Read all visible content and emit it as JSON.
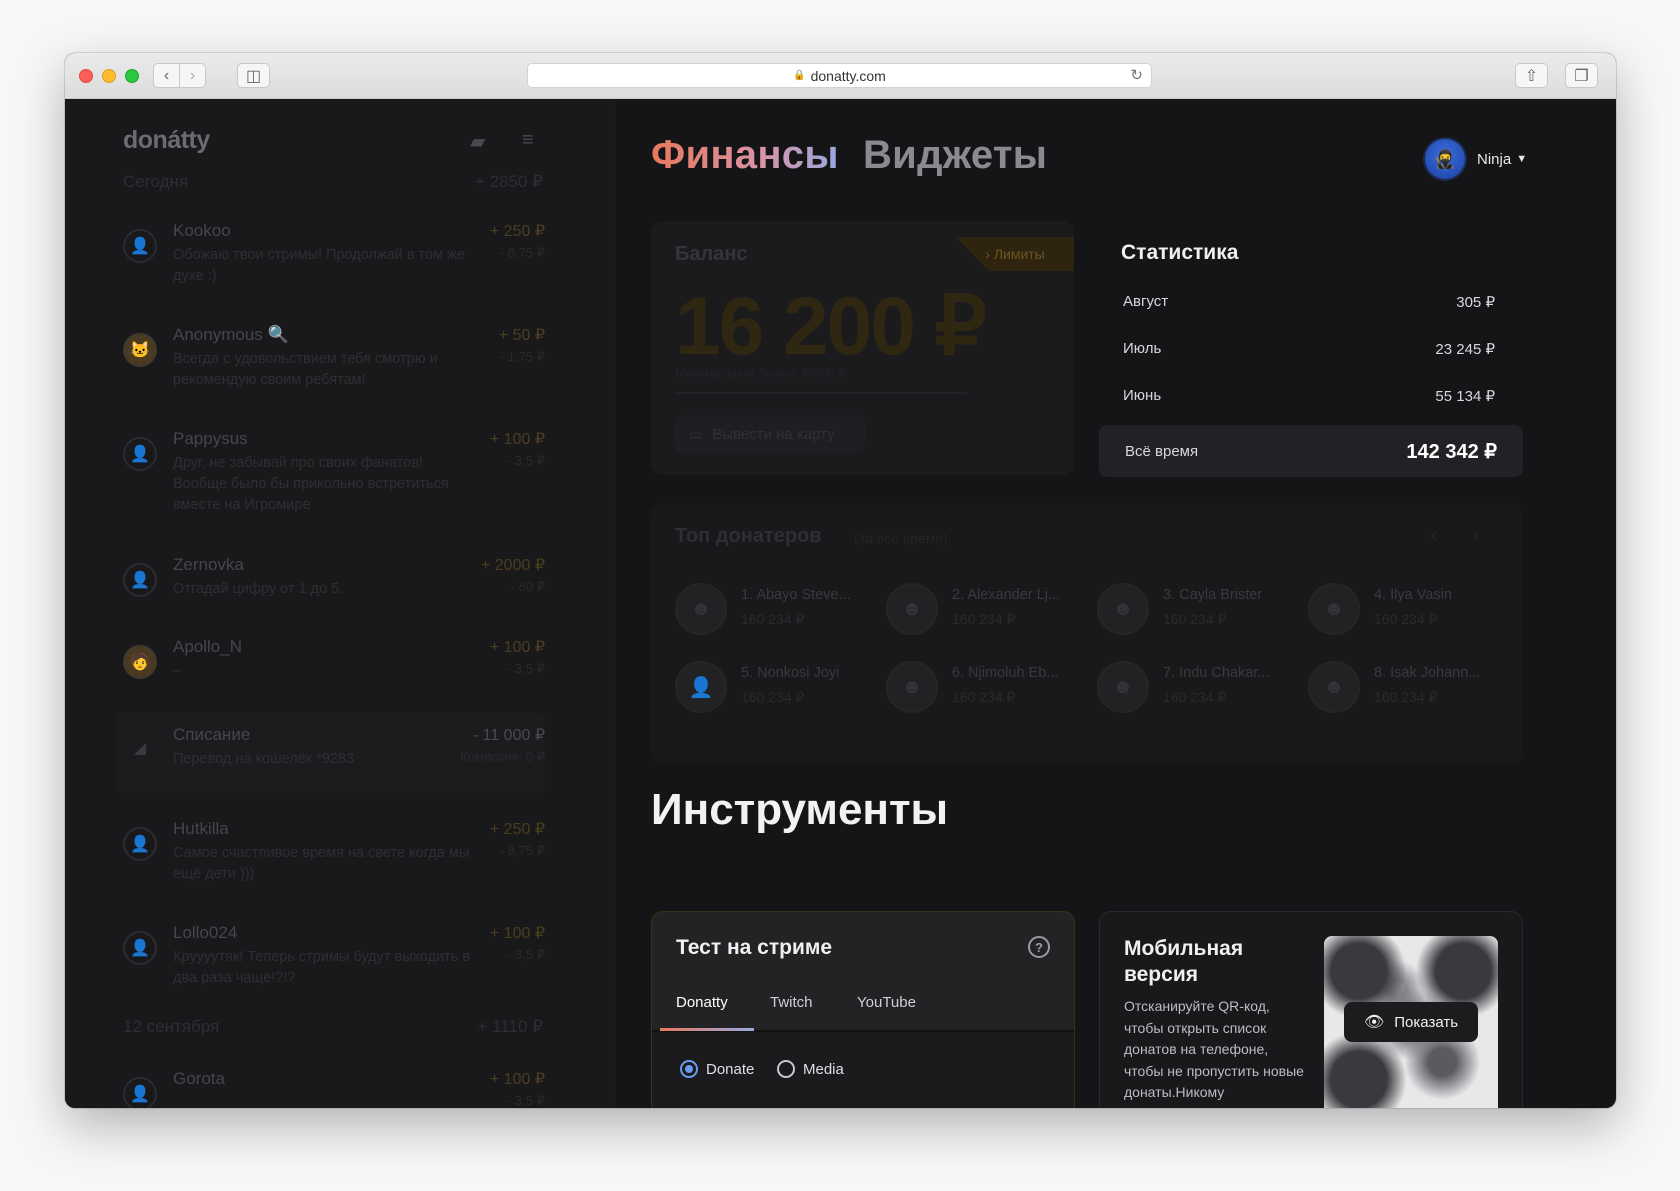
{
  "browser": {
    "url": "donatty.com"
  },
  "sidebar": {
    "logo": "donátty",
    "groups": [
      {
        "day": "Сегодня",
        "sum": "+ 2850 ₽"
      },
      {
        "day": "12 сентября",
        "sum": "+ 1110 ₽"
      }
    ],
    "items": [
      {
        "name": "Kookoo",
        "message": "Обожаю твои стримы! Продолжай в том же духе :)",
        "amount": "+ 250 ₽",
        "fee": "- 8,75 ₽"
      },
      {
        "name": "Anonymous 🔍",
        "message": "Всегда с удовольствием тебя смотрю и рекомендую своим ребятам!",
        "amount": "+ 50 ₽",
        "fee": "- 1,75 ₽"
      },
      {
        "name": "Pappysus",
        "message": "Друг, не забывай про своих фанатов! Вообще было бы прикольно встретиться вместе на Игромире",
        "amount": "+ 100 ₽",
        "fee": "- 3,5 ₽"
      },
      {
        "name": "Zernovka",
        "message": "Отгадай цифру от 1 до 5.",
        "amount": "+ 2000 ₽",
        "fee": "- 80 ₽"
      },
      {
        "name": "Apollo_N",
        "message": "–",
        "amount": "+ 100 ₽",
        "fee": "- 3,5 ₽"
      },
      {
        "name": "Списание",
        "message": "Перевод на кошелёк *9283",
        "amount": "- 11 000 ₽",
        "fee": "Комиссия: 0 ₽"
      },
      {
        "name": "Hutkilla",
        "message": "Самое счастливое время на свете когда мы ещё дети )))",
        "amount": "+ 250 ₽",
        "fee": "- 8,75 ₽"
      },
      {
        "name": "Lollo024",
        "message": "Круууутяк! Теперь стримы будут выходить в два раза чаще!?!?",
        "amount": "+ 100 ₽",
        "fee": "- 3,5 ₽"
      },
      {
        "name": "Gorota",
        "message": "",
        "amount": "+ 100 ₽",
        "fee": "- 3,5 ₽"
      }
    ]
  },
  "header": {
    "tab_finance": "Финансы",
    "tab_widgets": "Виджеты",
    "user_name": "Ninja"
  },
  "balance": {
    "label": "Баланс",
    "limits": "Лимиты",
    "amount": "16 200 ₽",
    "subtext": "Минимальный баланс 40000 ₽",
    "withdraw": "Вывести на карту"
  },
  "stats": {
    "title": "Статистика",
    "rows": [
      {
        "label": "Август",
        "value": "305 ₽"
      },
      {
        "label": "Июль",
        "value": "23 245 ₽"
      },
      {
        "label": "Июнь",
        "value": "55 134 ₽"
      }
    ],
    "all_time_label": "Всё время",
    "all_time_value": "142 342 ₽"
  },
  "top_donors": {
    "title": "Топ донатеров",
    "hint": "(за всё время)",
    "donors": [
      {
        "name": "1. Abayo Steve...",
        "sum": "160 234 ₽"
      },
      {
        "name": "2. Alexander Lj...",
        "sum": "160 234 ₽"
      },
      {
        "name": "3. Cayla Brister",
        "sum": "160 234 ₽"
      },
      {
        "name": "4. Ilya Vasin",
        "sum": "160 234 ₽"
      },
      {
        "name": "5. Nonkosi Joyi",
        "sum": "160 234 ₽"
      },
      {
        "name": "6. Njimoluh Eb...",
        "sum": "160 234 ₽"
      },
      {
        "name": "7. Indu Chakar...",
        "sum": "160 234 ₽"
      },
      {
        "name": "8. Isak Johann...",
        "sum": "160 234 ₽"
      }
    ]
  },
  "tools": {
    "title": "Инструменты",
    "test": {
      "title": "Тест на стриме",
      "tabs": [
        "Donatty",
        "Twitch",
        "YouTube"
      ],
      "radios": [
        "Donate",
        "Media"
      ]
    },
    "mobile": {
      "title": "Мобильная версия",
      "description": "Отсканируйте QR-код, чтобы открыть список донатов на телефоне, чтобы не пропустить новые донаты.Никому",
      "show_button": "Показать"
    }
  }
}
